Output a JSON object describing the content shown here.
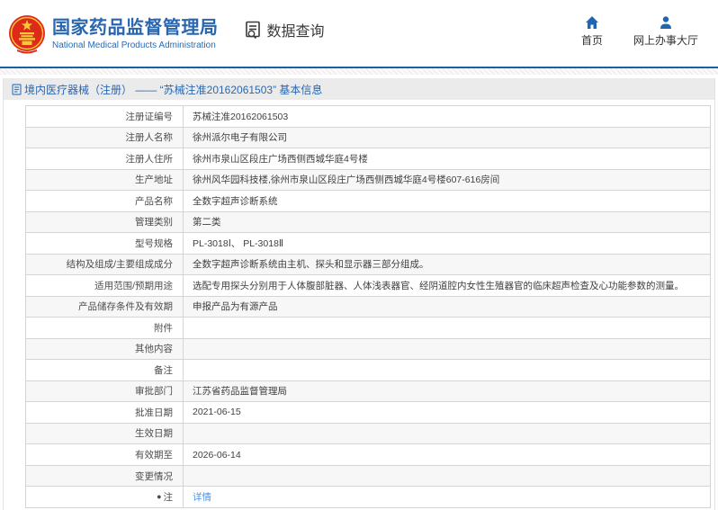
{
  "header": {
    "agency_name_cn": "国家药品监督管理局",
    "agency_name_en": "National Medical Products Administration",
    "data_query_label": "数据查询",
    "nav_home": "首页",
    "nav_service_hall": "网上办事大厅"
  },
  "page": {
    "section_title": "境内医疗器械（注册） —— “苏械注准20162061503” 基本信息"
  },
  "table": {
    "rows": [
      {
        "label": "注册证编号",
        "value": "苏械注准20162061503"
      },
      {
        "label": "注册人名称",
        "value": "徐州派尔电子有限公司"
      },
      {
        "label": "注册人住所",
        "value": "徐州市泉山区段庄广场西侧西城华庭4号楼"
      },
      {
        "label": "生产地址",
        "value": "徐州风华园科技楼,徐州市泉山区段庄广场西侧西城华庭4号楼607-616房间"
      },
      {
        "label": "产品名称",
        "value": "全数字超声诊断系统"
      },
      {
        "label": "管理类别",
        "value": "第二类"
      },
      {
        "label": "型号规格",
        "value": "PL-3018Ⅰ、 PL-3018Ⅱ"
      },
      {
        "label": "结构及组成/主要组成成分",
        "value": "全数字超声诊断系统由主机、探头和显示器三部分组成。"
      },
      {
        "label": "适用范围/预期用途",
        "value": "选配专用探头分别用于人体腹部脏器、人体浅表器官、经阴道腔内女性生殖器官的临床超声检查及心功能参数的测量。"
      },
      {
        "label": "产品储存条件及有效期",
        "value": "申报产品为有源产品"
      },
      {
        "label": "附件",
        "value": ""
      },
      {
        "label": "其他内容",
        "value": ""
      },
      {
        "label": "备注",
        "value": ""
      },
      {
        "label": "审批部门",
        "value": "江苏省药品监督管理局"
      },
      {
        "label": "批准日期",
        "value": "2021-06-15"
      },
      {
        "label": "生效日期",
        "value": ""
      },
      {
        "label": "有效期至",
        "value": "2026-06-14"
      },
      {
        "label": "变更情况",
        "value": ""
      },
      {
        "label": "注",
        "label_icon": "note-icon",
        "value": "详情",
        "link": true
      }
    ]
  },
  "colors": {
    "brand_blue": "#2a66ae",
    "divider_blue": "#1b5fa6",
    "link_blue": "#4f94e5",
    "emblem_red": "#de2a18",
    "emblem_gold": "#f7c83a",
    "title_bar_bg": "#ebebeb",
    "alt_row_bg": "#f7f7f7"
  }
}
